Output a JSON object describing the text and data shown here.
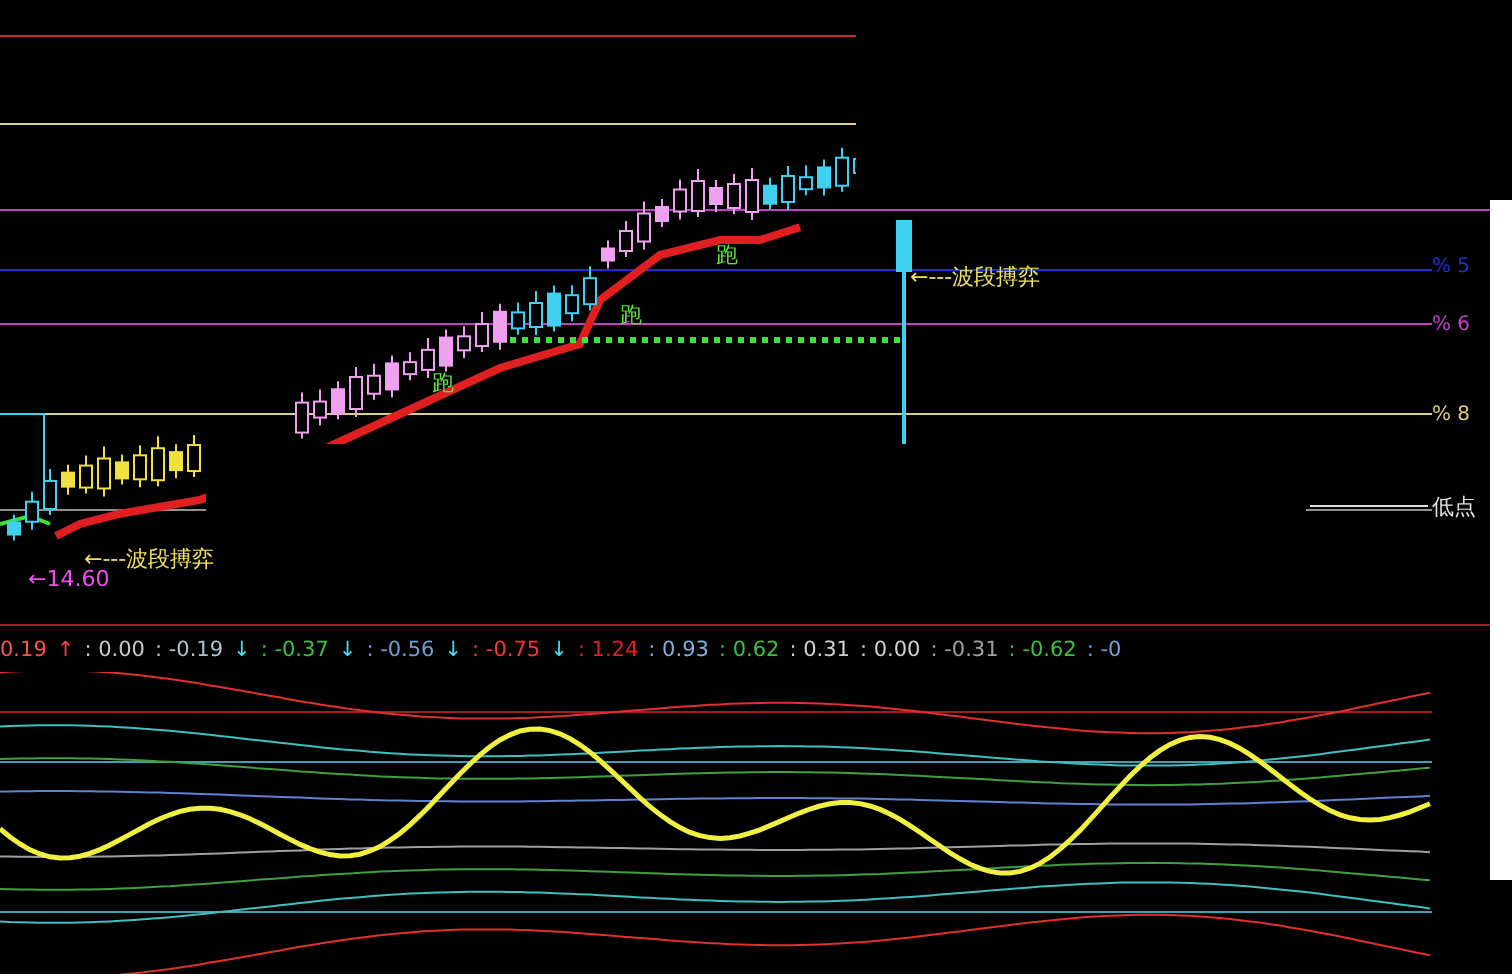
{
  "chart": {
    "markers": [
      {
        "text": "跑"
      },
      {
        "text": "跑"
      },
      {
        "text": "跑"
      }
    ],
    "annotations": [
      {
        "text": "←---波段搏弈"
      },
      {
        "text": "←---波段搏弈"
      }
    ],
    "price_label": "←14.60",
    "levels": [
      {
        "text": "% 5",
        "color": "#2030d0"
      },
      {
        "text": "% 6",
        "color": "#c040c0"
      },
      {
        "text": "% 8",
        "color": "#d8d080"
      }
    ],
    "low_label": "低点"
  },
  "indicator": {
    "readings": [
      {
        "text": "0.19",
        "color": "#ff5050"
      },
      {
        "text": "↑",
        "color": "#ff4040"
      },
      {
        "text": ": 0.00",
        "color": "#c8c8c8"
      },
      {
        "text": ": -0.19",
        "color": "#b0c0d0"
      },
      {
        "text": "↓",
        "color": "#40e0f0"
      },
      {
        "text": ": -0.37",
        "color": "#40c040"
      },
      {
        "text": "↓",
        "color": "#40e0f0"
      },
      {
        "text": ": -0.56",
        "color": "#70a0d0"
      },
      {
        "text": "↓",
        "color": "#40e0f0"
      },
      {
        "text": ": -0.75",
        "color": "#ff3030"
      },
      {
        "text": "↓",
        "color": "#40e0f0"
      },
      {
        "text": ": 1.24",
        "color": "#e02020"
      },
      {
        "text": ": 0.93",
        "color": "#80b0e0"
      },
      {
        "text": ": 0.62",
        "color": "#40c040"
      },
      {
        "text": ": 0.31",
        "color": "#d0d0d0"
      },
      {
        "text": ": 0.00",
        "color": "#d0d0d0"
      },
      {
        "text": ": -0.31",
        "color": "#a0a0a0"
      },
      {
        "text": ": -0.62",
        "color": "#40c040"
      },
      {
        "text": ": -0",
        "color": "#70a0d0"
      }
    ]
  }
}
